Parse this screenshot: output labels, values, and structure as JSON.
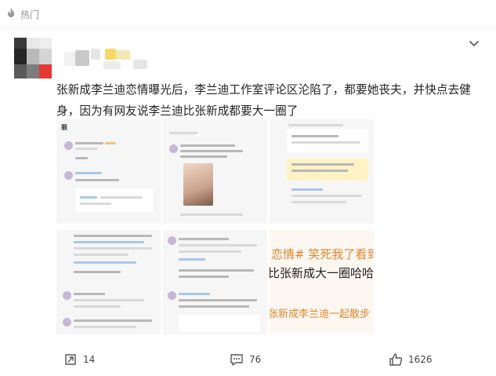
{
  "header": {
    "label": "热门",
    "icon": "fire-icon"
  },
  "post": {
    "text": "张新成李兰迪恋情曝光后，李兰迪工作室评论区沦陷了，都要她丧夫，并快点去健身，因为有网友说李兰迪比张新成都要大一圈了"
  },
  "grid": {
    "cell1_title": "狠",
    "cell9_line1": "恋情#  笑死我了看到一",
    "cell9_line2": "比张新成大一圈哈哈哈",
    "cell9_line3": "张新成李兰迪一起散步"
  },
  "footer": {
    "repost_count": "14",
    "comment_count": "76",
    "like_count": "1626"
  },
  "colors": {
    "accent_orange": "#f28c28",
    "text": "#222222",
    "muted": "#939393"
  }
}
